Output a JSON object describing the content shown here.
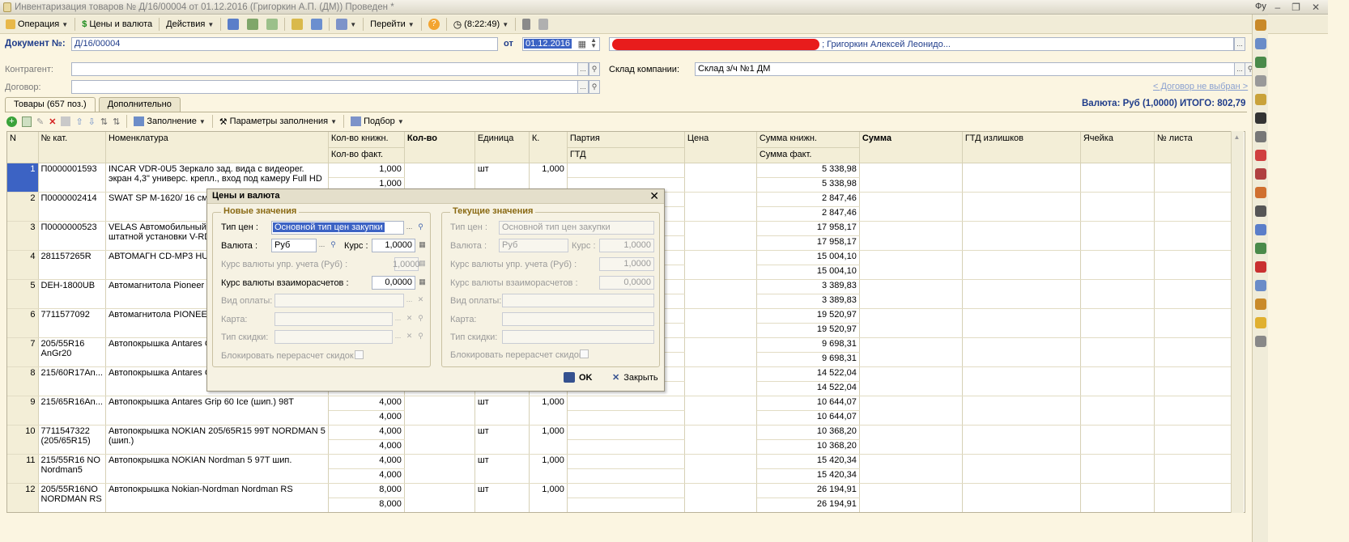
{
  "window": {
    "title": "Инвентаризация товаров № Д/16/00004 от 01.12.2016 (Григоркин А.П. (ДМ)) Проведен *",
    "right_fragment": "Фу"
  },
  "toolbar": {
    "operation": "Операция",
    "prices": "Цены и валюта",
    "actions": "Действия",
    "goto": "Перейти",
    "time": "(8:22:49)"
  },
  "header": {
    "doc_label": "Документ №:",
    "doc_number": "Д/16/00004",
    "from_label": "от",
    "date": "01.12.2016",
    "responsible_suffix": "; Григоркин Алексей Леонидо...",
    "counterparty_label": "Контрагент:",
    "contract_label": "Договор:",
    "warehouse_label": "Склад компании:",
    "warehouse_value": "Склад з/ч №1 ДМ",
    "contract_link": "< Договор не выбран >",
    "currency_total": "Валюта: Руб (1,0000) ИТОГО: 802,79"
  },
  "tabs": [
    {
      "label": "Товары (657 поз.)"
    },
    {
      "label": "Дополнительно"
    }
  ],
  "grid_toolbar": {
    "fill": "Заполнение",
    "fill_params": "Параметры заполнения",
    "selection": "Подбор"
  },
  "columns": {
    "n": "N",
    "cat": "№ кат.",
    "nom": "Номенклатура",
    "qty_book": "Кол-во книжн.",
    "qty_fact": "Кол-во факт.",
    "qty": "Кол-во",
    "unit": "Единица",
    "k": "К.",
    "party": "Партия",
    "gtd": "ГТД",
    "price": "Цена",
    "sum_book": "Сумма книжн.",
    "sum_fact": "Сумма факт.",
    "sum": "Сумма",
    "gtd_surplus": "ГТД излишков",
    "cell": "Ячейка",
    "sheet": "№ листа"
  },
  "rows": [
    {
      "n": "1",
      "cat": "П0000001593",
      "nom1": "INCAR VDR-0U5 Зеркало зад. вида с видеорег.",
      "nom2": "экран 4,3\" универс. крепл., вход под камеру Full HD",
      "qb": "1,000",
      "qf": "1,000",
      "unit": "шт",
      "k": "1,000",
      "sb": "5 338,98",
      "sf": "5 338,98"
    },
    {
      "n": "2",
      "cat": "П0000002414",
      "nom1": "SWAT SP M-1620/ 16 см и",
      "nom2": "",
      "qb": "",
      "qf": "",
      "unit": "",
      "k": "",
      "sb": "2 847,46",
      "sf": "2 847,46"
    },
    {
      "n": "3",
      "cat": "П0000000523",
      "nom1": "VELAS Автомобильный D",
      "nom2": "штатной установки  V-RD",
      "qb": "",
      "qf": "",
      "unit": "",
      "k": "",
      "sb": "17 958,17",
      "sf": "17 958,17"
    },
    {
      "n": "4",
      "cat": "281157265R",
      "nom1": "АВТОМАГН CD-MP3 HUM",
      "nom2": "",
      "qb": "",
      "qf": "",
      "unit": "",
      "k": "",
      "sb": "15 004,10",
      "sf": "15 004,10"
    },
    {
      "n": "5",
      "cat": "DEH-1800UB",
      "nom1": "Автомагнитола Pioneer D",
      "nom2": "",
      "qb": "",
      "qf": "",
      "unit": "",
      "k": "",
      "sb": "3 389,83",
      "sf": "3 389,83"
    },
    {
      "n": "6",
      "cat": "7711577092",
      "nom1": "Автомагнитола PIONEER",
      "nom2": "",
      "qb": "",
      "qf": "",
      "unit": "",
      "k": "",
      "sb": "19 520,97",
      "sf": "19 520,97"
    },
    {
      "n": "7",
      "cat": "205/55R16",
      "cat2": "AnGr20",
      "nom1": "Автопокрышка Antares Gr",
      "nom2": "",
      "qb": "",
      "qf": "",
      "unit": "",
      "k": "",
      "sb": "9 698,31",
      "sf": "9 698,31"
    },
    {
      "n": "8",
      "cat": "215/60R17An...",
      "nom1": "Автопокрышка Antares Gr",
      "nom2": "",
      "qb": "",
      "qf": "",
      "unit": "",
      "k": "",
      "sb": "14 522,04",
      "sf": "14 522,04"
    },
    {
      "n": "9",
      "cat": "215/65R16An...",
      "nom1": "Автопокрышка Antares Grip 60 Ice (шип.) 98T",
      "nom2": "",
      "qb": "4,000",
      "qf": "4,000",
      "unit": "шт",
      "k": "1,000",
      "sb": "10 644,07",
      "sf": "10 644,07"
    },
    {
      "n": "10",
      "cat": "7711547322",
      "cat2": "(205/65R15)",
      "nom1": "Автопокрышка NOKIAN 205/65R15 99T NORDMAN 5",
      "nom2": "(шип.)",
      "qb": "4,000",
      "qf": "4,000",
      "unit": "шт",
      "k": "1,000",
      "sb": "10 368,20",
      "sf": "10 368,20"
    },
    {
      "n": "11",
      "cat": "215/55R16 NO",
      "cat2": "Nordman5",
      "nom1": "Автопокрышка NOKIAN Nordman 5 97T шип.",
      "nom2": "",
      "qb": "4,000",
      "qf": "4,000",
      "unit": "шт",
      "k": "1,000",
      "sb": "15 420,34",
      "sf": "15 420,34"
    },
    {
      "n": "12",
      "cat": "205/55R16NO",
      "cat2": "NORDMAN RS",
      "nom1": "Автопокрышка Nokian-Nordman Nordman RS",
      "nom2": "",
      "qb": "8,000",
      "qf": "8,000",
      "unit": "шт",
      "k": "1,000",
      "sb": "26 194,91",
      "sf": "26 194,91"
    }
  ],
  "dialog": {
    "title": "Цены и валюта",
    "new_group": "Новые значения",
    "cur_group": "Текущие значения",
    "price_type_label": "Тип цен :",
    "price_type": "Основной тип цен закупки",
    "currency_label": "Валюта :",
    "currency": "Руб",
    "rate_label": "Курс :",
    "rate": "1,0000",
    "mgmt_rate_label": "Курс валюты упр. учета  (Руб) :",
    "mgmt_rate": "1,0000",
    "settle_rate_label": "Курс валюты взаиморасчетов :",
    "settle_rate": "0,0000",
    "payment_label": "Вид оплаты:",
    "card_label": "Карта:",
    "discount_label": "Тип скидки:",
    "block_label": "Блокировать перерасчет скидок",
    "ok": "OK",
    "close": "Закрыть"
  }
}
